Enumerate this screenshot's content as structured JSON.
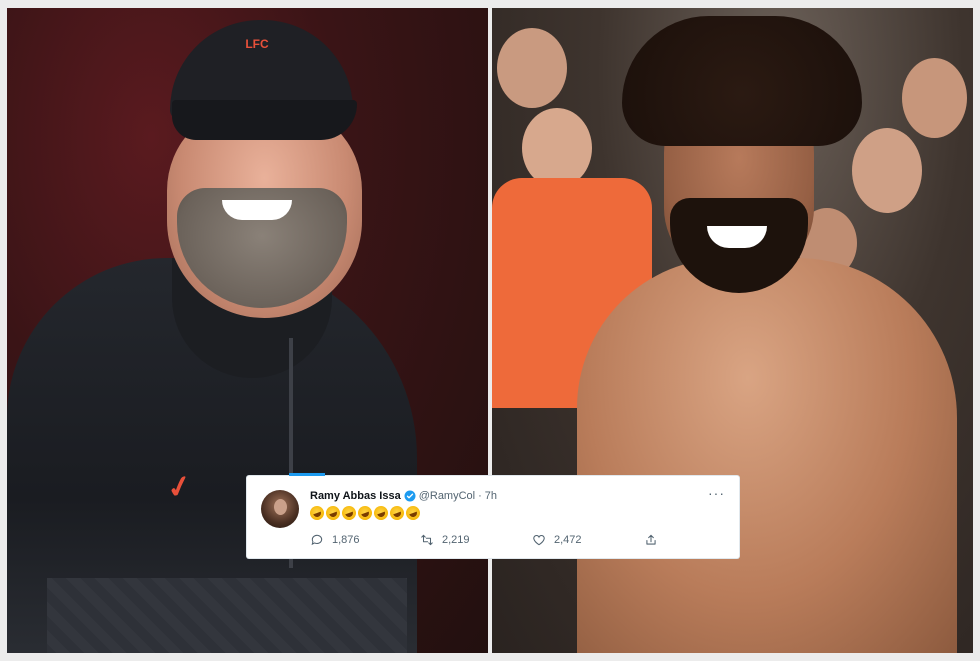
{
  "tweet": {
    "display_name": "Ramy Abbas Issa",
    "handle": "@RamyCol",
    "separator": "·",
    "time": "7h",
    "more": "···",
    "emoji_count_icon": "rolling-on-floor-laughing-emoji",
    "emojis": [
      "🤣",
      "🤣",
      "🤣",
      "🤣",
      "🤣",
      "🤣",
      "🤣"
    ],
    "replies": "1,876",
    "retweets": "2,219",
    "likes": "2,472"
  },
  "left_photo": {
    "cap_logo": "LFC"
  },
  "colors": {
    "accent": "#1d9bf0",
    "verified": "#1d9bf0",
    "brand_red": "#e8503a"
  }
}
